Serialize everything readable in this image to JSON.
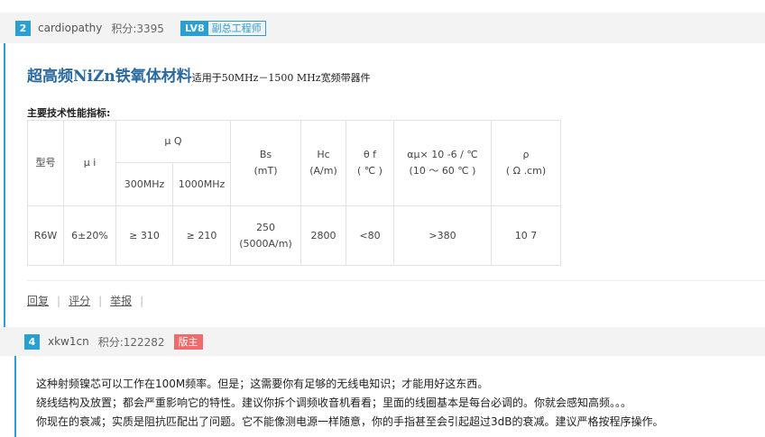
{
  "post1": {
    "floor": "2",
    "username": "cardiopathy",
    "score": "积分:3395",
    "level": "LV8",
    "level_title": "副总工程师",
    "title_main": "超高频NiZn铁氧体材料",
    "title_sub": "适用于50MHz－1500 MHz宽频带器件",
    "spec_label": "主要技术性能指标:",
    "table": {
      "h_model": "型号",
      "h_mui": "μ i",
      "h_muq": "μ Q",
      "h_300": "300MHz",
      "h_1000": "1000MHz",
      "h_bs1": "Bs",
      "h_bs2": "(mT)",
      "h_hc1": "Hc",
      "h_hc2": "(A/m)",
      "h_theta1": "θ f",
      "h_theta2": "( ℃ )",
      "h_alpha1": "αμ× 10 -6 / ℃",
      "h_alpha2": "(10 ～ 60 ℃ )",
      "h_rho1": "ρ",
      "h_rho2": "( Ω .cm)",
      "r_model": "R6W",
      "r_mui": "6±20%",
      "r_300": "≥ 310",
      "r_1000": "≥ 210",
      "r_bs1": "250",
      "r_bs2": "(5000A/m)",
      "r_hc": "2800",
      "r_theta": "<80",
      "r_alpha": ">380",
      "r_rho": "10 7"
    },
    "actions": {
      "reply": "回复",
      "rate": "评分",
      "report": "举报"
    }
  },
  "post2": {
    "floor": "4",
    "username": "xkw1cn",
    "score": "积分:122282",
    "badge": "版主",
    "lines": [
      "这种射频镍芯可以工作在100M频率。但是；这需要你有足够的无线电知识；才能用好这东西。",
      "绕线结构及放置；都会严重影响它的特性。建议你拆个调频收音机看看；里面的线圈基本是每台必调的。你就会感知高频。。。",
      "你现在的衰减；实质是阻抗匹配出了问题。它不能像测电源一样随意，你的手指甚至会引起超过3dB的衰减。建议严格按程序操作。"
    ]
  },
  "colors": {
    "accent": "#2a9fd6",
    "moderator": "#f06a6a",
    "title": "#2b6aa0"
  }
}
